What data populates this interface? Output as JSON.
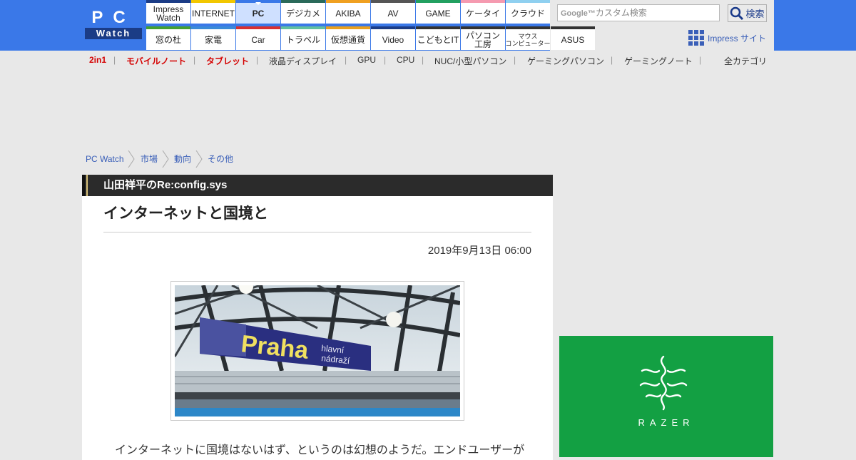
{
  "colors": {
    "brand_blue": "#3a78e8",
    "active_tab": "#cfe0ff",
    "link_blue": "#3a5fb8",
    "red_category": "#d40000",
    "series_bar": "#2b2b2b",
    "ad_green": "#13a043"
  },
  "logo": {
    "top": "PC",
    "bottom": "Watch"
  },
  "nav": {
    "row1": [
      {
        "label": "Impress\nWatch",
        "color": "#1b3c86"
      },
      {
        "label": "INTERNET",
        "color": "#f2c700"
      },
      {
        "label": "PC",
        "color": "#3a78e8",
        "active": true
      },
      {
        "label": "デジカメ",
        "color": "#2a6a5a"
      },
      {
        "label": "AKIBA",
        "color": "#f0a020"
      },
      {
        "label": "AV",
        "color": "#555555"
      },
      {
        "label": "GAME",
        "color": "#22a060"
      },
      {
        "label": "ケータイ",
        "color": "#f59ab0"
      },
      {
        "label": "クラウド",
        "color": "#8fd0f0"
      }
    ],
    "row2": [
      {
        "label": "窓の杜",
        "color": "#44a030"
      },
      {
        "label": "家電",
        "color": "#3a8ad8"
      },
      {
        "label": "Car",
        "color": "#d83030"
      },
      {
        "label": "トラベル",
        "color": "#60c0a0"
      },
      {
        "label": "仮想通貨",
        "color": "#e8a020"
      },
      {
        "label": "Video",
        "color": "#1b3c86"
      },
      {
        "label": "こどもとIT",
        "color": "#333333"
      },
      {
        "label": "パソコン\n工房",
        "color": "#333333"
      },
      {
        "label": "マウス\nコンピューター",
        "color": "#333333",
        "small": true
      },
      {
        "label": "ASUS",
        "color": "#333333"
      }
    ]
  },
  "search": {
    "google_label": "Google™",
    "placeholder": "カスタム検索",
    "button_label": "検索",
    "icon": "magnifier-icon"
  },
  "impress_site": {
    "label": "Impress サイト",
    "icon": "grid-icon"
  },
  "categories": {
    "items": [
      {
        "label": "2in1",
        "red": true
      },
      {
        "label": "モバイルノート",
        "red": true
      },
      {
        "label": "タブレット",
        "red": true
      },
      {
        "label": "液晶ディスプレイ"
      },
      {
        "label": "GPU"
      },
      {
        "label": "CPU"
      },
      {
        "label": "NUC/小型パソコン"
      },
      {
        "label": "ゲーミングパソコン"
      },
      {
        "label": "ゲーミングノート"
      }
    ],
    "all_label": "全カテゴリ"
  },
  "breadcrumb": [
    "PC Watch",
    "市場",
    "動向",
    "その他"
  ],
  "article": {
    "series": "山田祥平のRe:config.sys",
    "title": "インターネットと国境と",
    "date": "2019年9月13日 06:00",
    "photo": {
      "sign_text": "Praha",
      "sign_sub1": "hlavní",
      "sign_sub2": "nádraží"
    },
    "body_first_line": "インターネットに国境はないはず、というのは幻想のようだ。エンドユーザーが"
  },
  "ad": {
    "brand": "RAZER",
    "icon": "razer-snake-icon"
  }
}
